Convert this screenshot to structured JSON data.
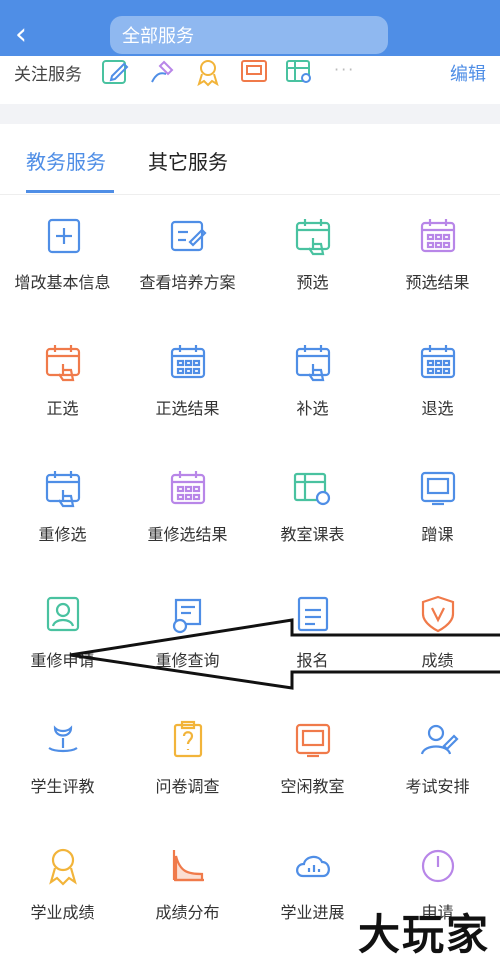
{
  "topbar": {
    "back_icon": "chevron-left-icon",
    "search_placeholder": "全部服务"
  },
  "follow": {
    "label": "关注服务",
    "icons": [
      "edit-icon",
      "hand-pen-icon",
      "medal-icon",
      "screen-icon",
      "table-search-icon"
    ],
    "more": "···",
    "edit_label": "编辑"
  },
  "tabs": {
    "active": "教务服务",
    "other": "其它服务"
  },
  "grid": {
    "items": [
      {
        "label": "增改基本信息",
        "icon": "plus-square-icon",
        "color": "#4f8ee6"
      },
      {
        "label": "查看培养方案",
        "icon": "edit-doc-icon",
        "color": "#4f8ee6"
      },
      {
        "label": "预选",
        "icon": "calendar-hand-icon",
        "color": "#49c2a0"
      },
      {
        "label": "预选结果",
        "icon": "calendar-grid-icon",
        "color": "#b886e8"
      },
      {
        "label": "正选",
        "icon": "calendar-hand-icon",
        "color": "#f07a4a"
      },
      {
        "label": "正选结果",
        "icon": "calendar-grid-icon",
        "color": "#4f8ee6"
      },
      {
        "label": "补选",
        "icon": "calendar-hand-icon",
        "color": "#4f8ee6"
      },
      {
        "label": "退选",
        "icon": "calendar-grid-icon",
        "color": "#4f8ee6"
      },
      {
        "label": "重修选",
        "icon": "calendar-hand-icon",
        "color": "#4f8ee6"
      },
      {
        "label": "重修选结果",
        "icon": "calendar-grid-icon",
        "color": "#b886e8"
      },
      {
        "label": "教室课表",
        "icon": "table-search-icon",
        "color": "#49c2a0"
      },
      {
        "label": "蹭课",
        "icon": "screen-icon",
        "color": "#4f8ee6"
      },
      {
        "label": "重修申请",
        "icon": "portrait-icon",
        "color": "#49c2a0"
      },
      {
        "label": "重修查询",
        "icon": "scroll-search-icon",
        "color": "#4f8ee6"
      },
      {
        "label": "报名",
        "icon": "document-icon",
        "color": "#4f8ee6"
      },
      {
        "label": "成绩",
        "icon": "shield-v-icon",
        "color": "#f07a4a"
      },
      {
        "label": "学生评教",
        "icon": "flower-hand-icon",
        "color": "#4f8ee6"
      },
      {
        "label": "问卷调查",
        "icon": "clipboard-question-icon",
        "color": "#f2b43a"
      },
      {
        "label": "空闲教室",
        "icon": "screen-icon",
        "color": "#f07a4a"
      },
      {
        "label": "考试安排",
        "icon": "user-pen-icon",
        "color": "#4f8ee6"
      },
      {
        "label": "学业成绩",
        "icon": "medal-icon",
        "color": "#f2b43a"
      },
      {
        "label": "成绩分布",
        "icon": "chart-curve-icon",
        "color": "#f07a4a"
      },
      {
        "label": "学业进展",
        "icon": "cloud-chart-icon",
        "color": "#4f8ee6"
      },
      {
        "label": "申请",
        "icon": "clock-icon",
        "color": "#b886e8"
      }
    ]
  },
  "watermark": "大玩家"
}
